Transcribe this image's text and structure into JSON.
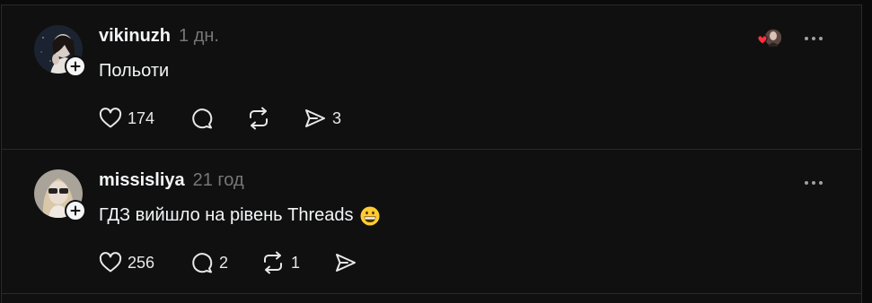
{
  "posts": [
    {
      "username": "vikinuzh",
      "time": "1 дн.",
      "text": "Польоти",
      "likes": "174",
      "comments": "",
      "reposts": "",
      "shares": "3",
      "liked_by_followed": true
    },
    {
      "username": "missisliya",
      "time": "21 год",
      "text": "ГДЗ вийшло на рівень Threads",
      "emoji": "grinning-face",
      "likes": "256",
      "comments": "2",
      "reposts": "1",
      "shares": ""
    }
  ],
  "colors": {
    "background": "#101010",
    "text": "#f3f5f7",
    "muted": "#777777",
    "divider": "#2a2a2a",
    "heart": "#ff3040"
  },
  "icons": [
    "heart-icon",
    "comment-icon",
    "repost-icon",
    "share-icon",
    "more-icon",
    "plus-icon"
  ]
}
